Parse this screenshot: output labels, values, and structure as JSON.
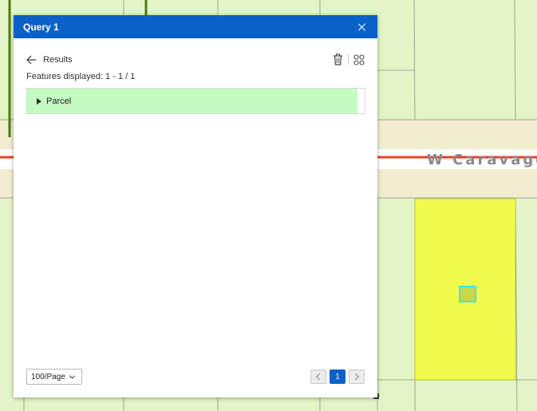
{
  "map": {
    "street_label": "W Caravaggi"
  },
  "widget": {
    "title": "Query 1",
    "results_label": "Results",
    "features_displayed": "Features displayed: 1 - 1 / 1",
    "results": [
      {
        "label": "Parcel"
      }
    ],
    "page_size": "100/Page",
    "current_page": "1"
  },
  "icons": {
    "close": "close-icon",
    "back": "arrow-left-icon",
    "delete": "trash-icon",
    "layout": "grid-icon",
    "expand": "triangle-right-icon",
    "dropdown": "chevron-down-icon",
    "prev": "chevron-left-icon",
    "next": "chevron-right-icon"
  },
  "colors": {
    "header": "#0a62c8",
    "result_highlight": "#c3fbc3",
    "parcel_fill": "#f2fc4c",
    "parcel_selected": "#c8d84a",
    "selection_outline": "#3fe3e6",
    "road_line": "#e8402a",
    "road_fill": "#f2ecd0",
    "land": "#e3f5c6"
  }
}
